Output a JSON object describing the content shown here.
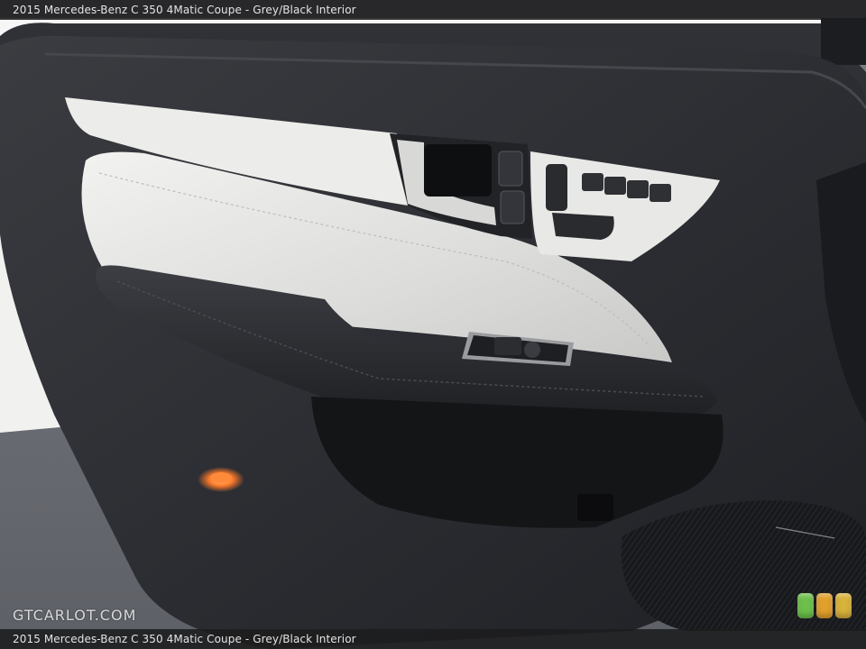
{
  "caption": {
    "top": "2015 Mercedes-Benz C 350 4Matic Coupe - Grey/Black Interior",
    "bottom": "2015 Mercedes-Benz C 350 4Matic Coupe - Grey/Black Interior"
  },
  "watermark": "GTCARLOT.COM",
  "photo": {
    "subject": "car-door-interior-panel",
    "colors": {
      "trim_black": "#2b2d31",
      "leather_grey": "#e1e1df",
      "pavement": "#70737a",
      "courtesy_light": "#ff7a2a"
    }
  },
  "rating_dots": [
    {
      "color": "#6cc04a"
    },
    {
      "color": "#e2a02c"
    },
    {
      "color": "#d8b23a"
    }
  ]
}
